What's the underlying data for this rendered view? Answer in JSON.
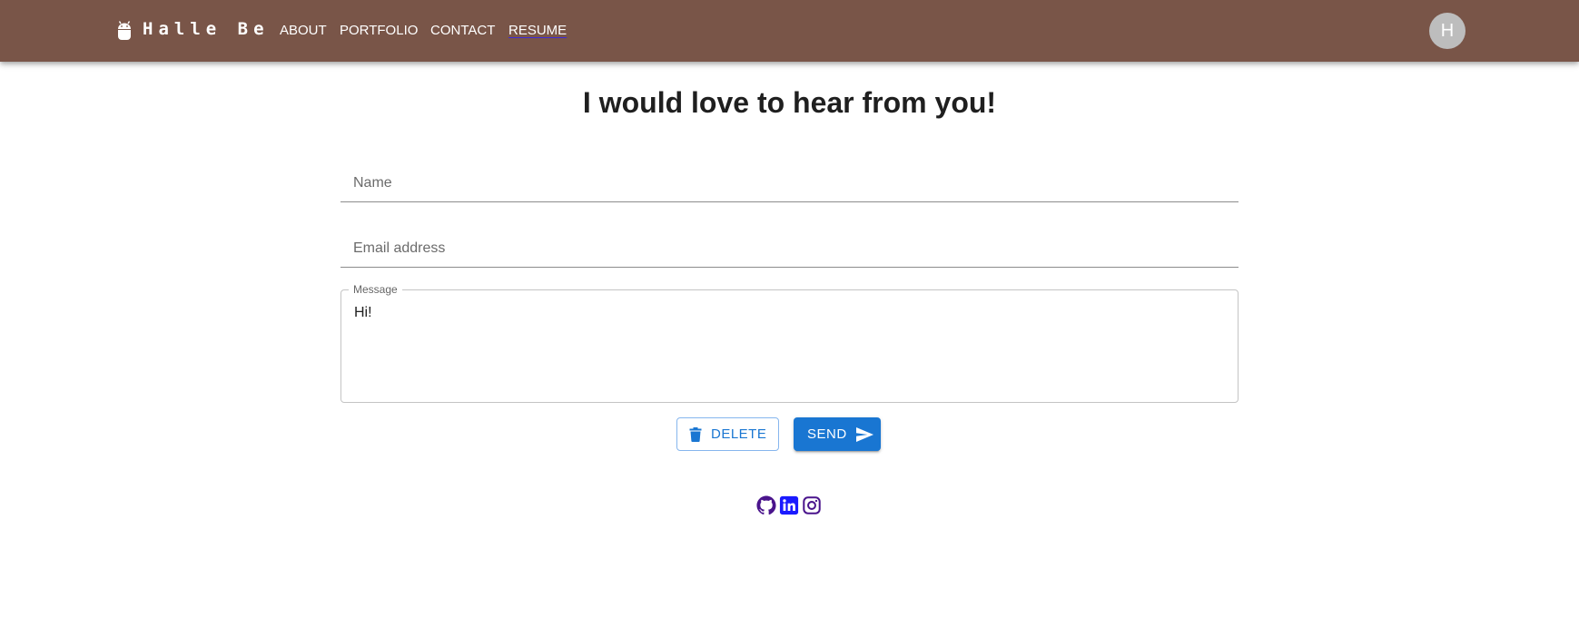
{
  "header": {
    "brand_name": "Halle Be",
    "brand_icon": "android-icon",
    "nav": [
      {
        "label": "ABOUT"
      },
      {
        "label": "PORTFOLIO"
      },
      {
        "label": "CONTACT"
      },
      {
        "label": "RESUME"
      }
    ],
    "active_nav": "RESUME",
    "avatar_letter": "H"
  },
  "main": {
    "title": "I would love to hear from you!",
    "form": {
      "name_placeholder": "Name",
      "email_placeholder": "Email address",
      "message_label": "Message",
      "message_value": "Hi!"
    },
    "buttons": {
      "delete_label": "DELETE",
      "send_label": "SEND"
    }
  },
  "footer": {
    "socials": [
      "github-icon",
      "linkedin-icon",
      "instagram-icon"
    ]
  },
  "colors": {
    "appbar": "#795548",
    "primary": "#1976d2",
    "avatar": "#bdbdbd",
    "social_icon": "#4a148c"
  }
}
